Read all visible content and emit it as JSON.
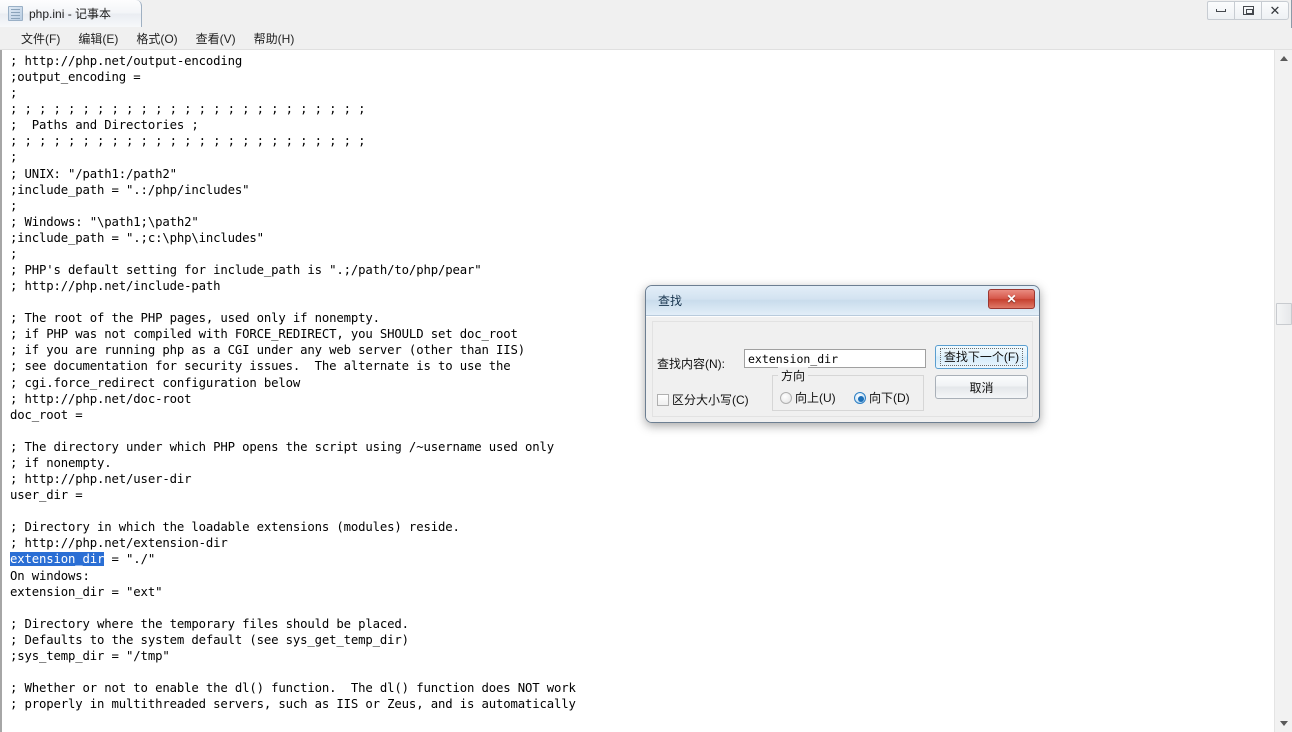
{
  "window": {
    "title": "php.ini - 记事本",
    "icon": "notepad-document-icon",
    "controls": {
      "minimize": "–",
      "maximize": "□",
      "close": "✕"
    }
  },
  "menu": {
    "items": [
      {
        "label": "文件(F)",
        "name": "menu-file"
      },
      {
        "label": "编辑(E)",
        "name": "menu-edit"
      },
      {
        "label": "格式(O)",
        "name": "menu-format"
      },
      {
        "label": "查看(V)",
        "name": "menu-view"
      },
      {
        "label": "帮助(H)",
        "name": "menu-help"
      }
    ]
  },
  "editor": {
    "text_before_selection": "; http://php.net/output-encoding\n;output_encoding =\n;\n; ; ; ; ; ; ; ; ; ; ; ; ; ; ; ; ; ; ; ; ; ; ; ; ;\n;  Paths and Directories ;\n; ; ; ; ; ; ; ; ; ; ; ; ; ; ; ; ; ; ; ; ; ; ; ; ;\n;\n; UNIX: \"/path1:/path2\"\n;include_path = \".:/php/includes\"\n;\n; Windows: \"\\path1;\\path2\"\n;include_path = \".;c:\\php\\includes\"\n;\n; PHP's default setting for include_path is \".;/path/to/php/pear\"\n; http://php.net/include-path\n\n; The root of the PHP pages, used only if nonempty.\n; if PHP was not compiled with FORCE_REDIRECT, you SHOULD set doc_root\n; if you are running php as a CGI under any web server (other than IIS)\n; see documentation for security issues.  The alternate is to use the\n; cgi.force_redirect configuration below\n; http://php.net/doc-root\ndoc_root =\n\n; The directory under which PHP opens the script using /~username used only\n; if nonempty.\n; http://php.net/user-dir\nuser_dir =\n\n; Directory in which the loadable extensions (modules) reside.\n; http://php.net/extension-dir\n",
    "selected_text": "extension_dir",
    "text_after_selection": " = \"./\"\nOn windows:\nextension_dir = \"ext\"\n\n; Directory where the temporary files should be placed.\n; Defaults to the system default (see sys_get_temp_dir)\n;sys_temp_dir = \"/tmp\"\n\n; Whether or not to enable the dl() function.  The dl() function does NOT work\n; properly in multithreaded servers, such as IIS or Zeus, and is automatically",
    "selection_color": "#2a6ed4",
    "selection_text_color": "#ffffff"
  },
  "find_dialog": {
    "title": "查找",
    "close_glyph": "✕",
    "search_label": "查找内容(N):",
    "search_value": "extension_dir",
    "find_next_button": "查找下一个(F)",
    "cancel_button": "取消",
    "match_case_label": "区分大小写(C)",
    "match_case_checked": false,
    "direction": {
      "legend": "方向",
      "up_label": "向上(U)",
      "down_label": "向下(D)",
      "selected": "向下(D)"
    }
  }
}
